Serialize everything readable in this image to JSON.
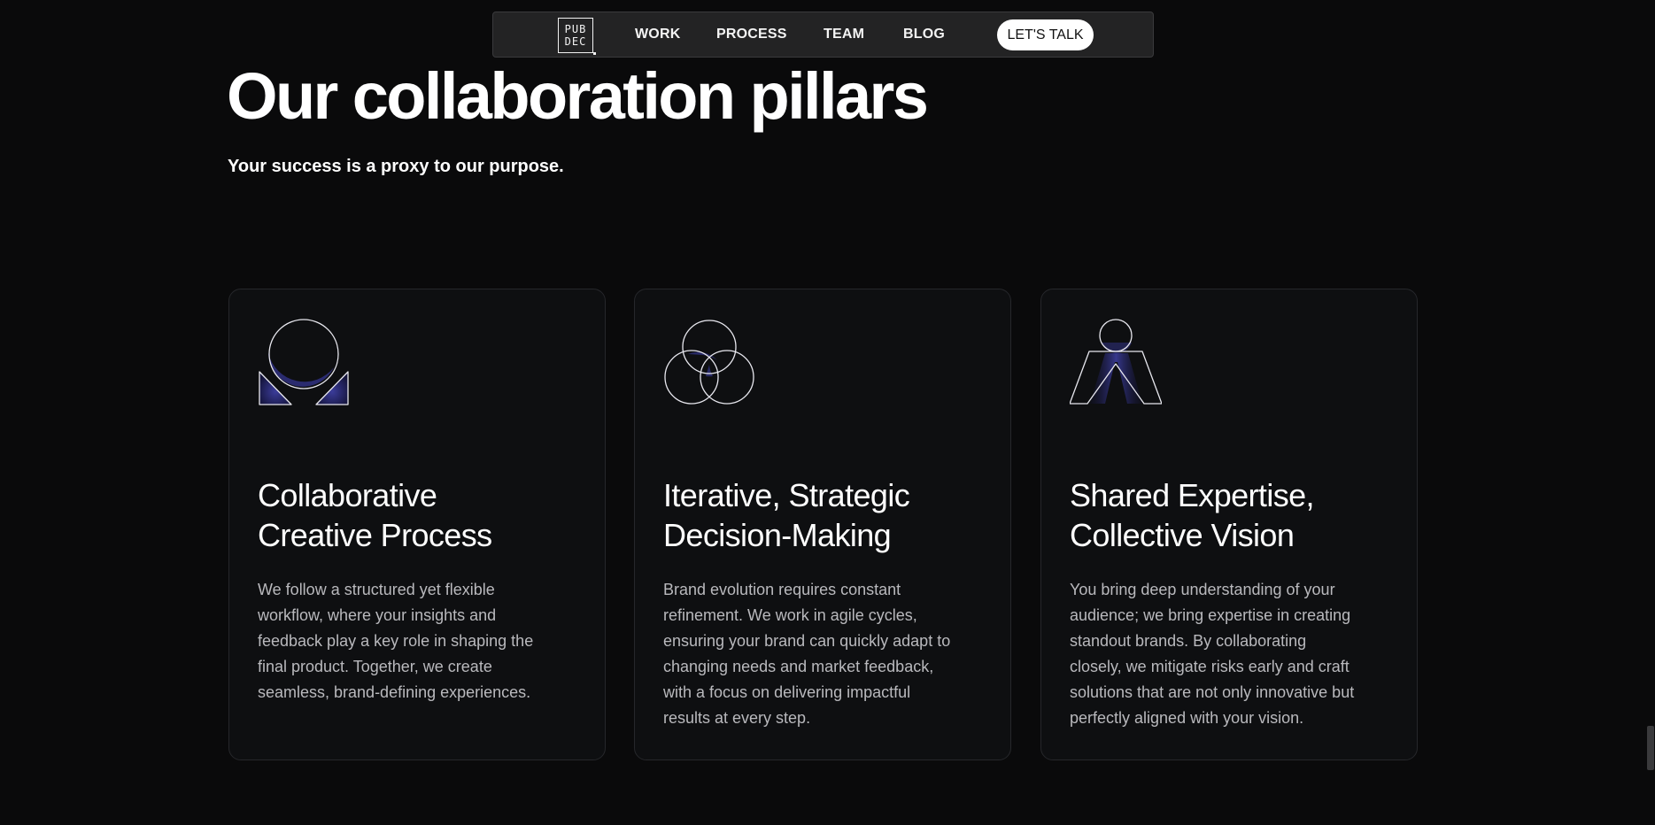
{
  "nav": {
    "logo_top": "PUB",
    "logo_bottom": "DEC",
    "links": [
      "WORK",
      "PROCESS",
      "TEAM",
      "BLOG"
    ],
    "cta": "LET'S TALK"
  },
  "hero": {
    "title": "Our collaboration pillars",
    "subtitle": "Your success is a proxy to our purpose."
  },
  "cards": [
    {
      "icon": "omega-circle-triangles-icon",
      "title_lines": [
        "Collaborative",
        "Creative Process"
      ],
      "text_lines": [
        "We follow a structured yet flexible",
        "workflow, where your insights and",
        "feedback play a key role in shaping the",
        "final product. Together, we create",
        "seamless, brand-defining experiences."
      ]
    },
    {
      "icon": "three-circles-venn-icon",
      "title_lines": [
        "Iterative, Strategic",
        "Decision-Making"
      ],
      "text_lines": [
        "Brand evolution requires constant",
        "refinement. We work in agile cycles,",
        "ensuring your brand can quickly adapt to",
        "changing needs and market feedback,",
        "with a focus on delivering impactful",
        "results at every step."
      ]
    },
    {
      "icon": "figure-circle-legs-icon",
      "title_lines": [
        "Shared Expertise,",
        "Collective Vision"
      ],
      "text_lines": [
        "You bring deep understanding of your",
        "audience; we bring expertise in creating",
        "standout brands. By collaborating",
        "closely, we mitigate risks early and craft",
        "solutions that are not only innovative but",
        "perfectly aligned with your vision."
      ]
    }
  ],
  "colors": {
    "background": "#0a0a0b",
    "card_background": "#0e0f11",
    "accent_purple": "#2e2f7a",
    "text_muted": "#b9b9bd"
  }
}
